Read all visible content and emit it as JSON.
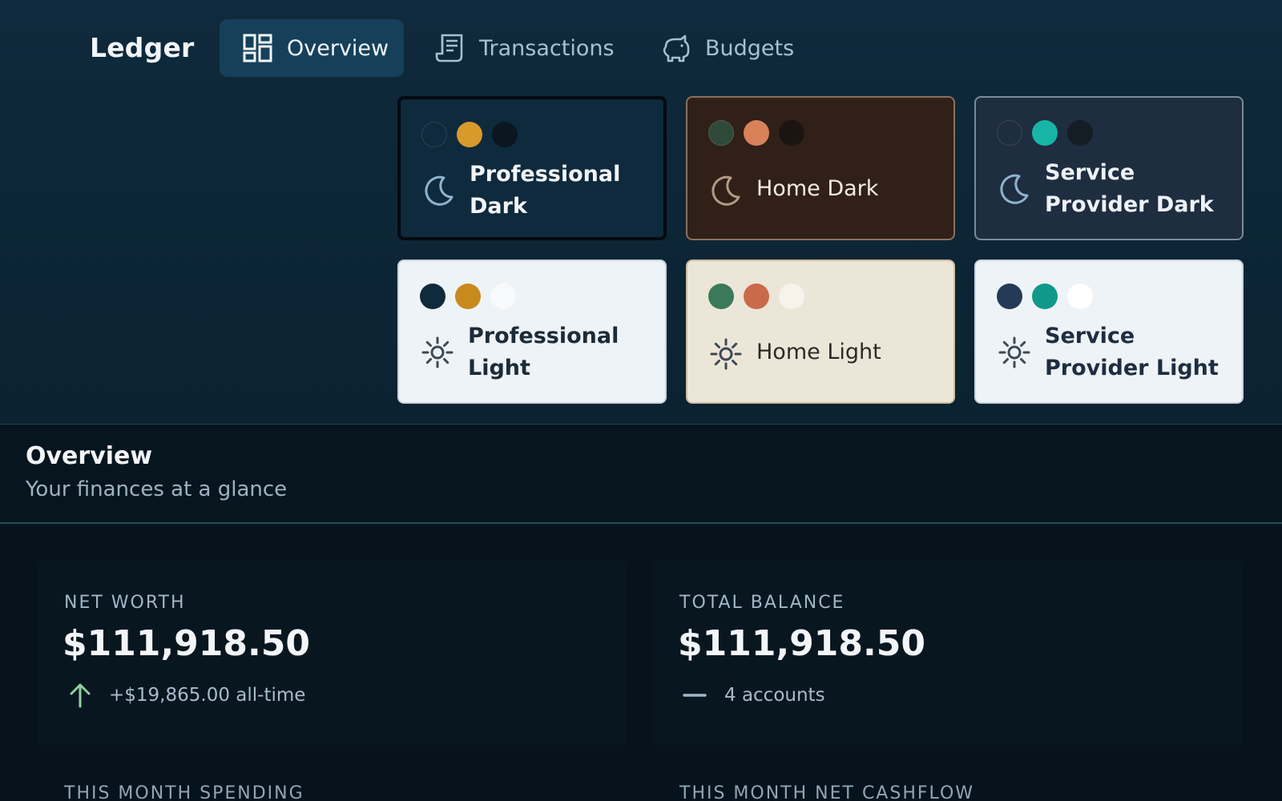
{
  "app": {
    "title": "Ledger"
  },
  "nav": {
    "tabs": [
      {
        "label": "Overview",
        "icon": "dashboard-icon",
        "active": true
      },
      {
        "label": "Transactions",
        "icon": "receipt-icon",
        "active": false
      },
      {
        "label": "Budgets",
        "icon": "piggy-bank-icon",
        "active": false
      }
    ]
  },
  "themes": [
    {
      "name": "Professional Dark",
      "mode": "dark",
      "icon": "moon-icon",
      "bg": "#0f2a3c",
      "fg": "#f1f5f8",
      "border": "#020a10",
      "swatches": [
        "#0f2a3c",
        "#d89a2a",
        "#0a1720"
      ],
      "selected": true
    },
    {
      "name": "Home Dark",
      "mode": "dark",
      "icon": "moon-icon",
      "bg": "#302018",
      "fg": "#f3ece4",
      "border": "#8a6f5e",
      "swatches": [
        "#2f4a38",
        "#d98158",
        "#1c1410"
      ],
      "selected": false
    },
    {
      "name": "Service Provider Dark",
      "mode": "dark",
      "icon": "moon-icon",
      "bg": "#1e2d40",
      "fg": "#eef2f7",
      "border": "#7a8a99",
      "swatches": [
        "#1e2d40",
        "#17b5a6",
        "#151d24"
      ],
      "selected": false
    },
    {
      "name": "Professional Light",
      "mode": "light",
      "icon": "sun-icon",
      "bg": "#eef3f7",
      "fg": "#1b2b38",
      "border": "#c9d4dc",
      "swatches": [
        "#0f2a3c",
        "#c98a1d",
        "#f7f9fb"
      ],
      "selected": false
    },
    {
      "name": "Home Light",
      "mode": "light",
      "icon": "sun-icon",
      "bg": "#ece6d8",
      "fg": "#2a2a26",
      "border": "#cdbf9f",
      "swatches": [
        "#3a7a5a",
        "#c96a4a",
        "#f7f3ea"
      ],
      "selected": false
    },
    {
      "name": "Service Provider Light",
      "mode": "light",
      "icon": "sun-icon",
      "bg": "#eef3f8",
      "fg": "#1e2d40",
      "border": "#c9d4dc",
      "swatches": [
        "#253a56",
        "#10998a",
        "#ffffff"
      ],
      "selected": false
    }
  ],
  "overview": {
    "title": "Overview",
    "subtitle": "Your finances at a glance"
  },
  "stats": [
    {
      "label": "NET WORTH",
      "value": "$111,918.50",
      "foot": "+$19,865.00 all-time",
      "foot_icon": "arrow-up-icon",
      "accent": "#8fd19e"
    },
    {
      "label": "TOTAL BALANCE",
      "value": "$111,918.50",
      "foot": "4 accounts",
      "foot_icon": "dash-icon",
      "accent": "#9fb7c6"
    }
  ],
  "lower_labels": [
    "THIS MONTH SPENDING",
    "THIS MONTH NET CASHFLOW"
  ]
}
